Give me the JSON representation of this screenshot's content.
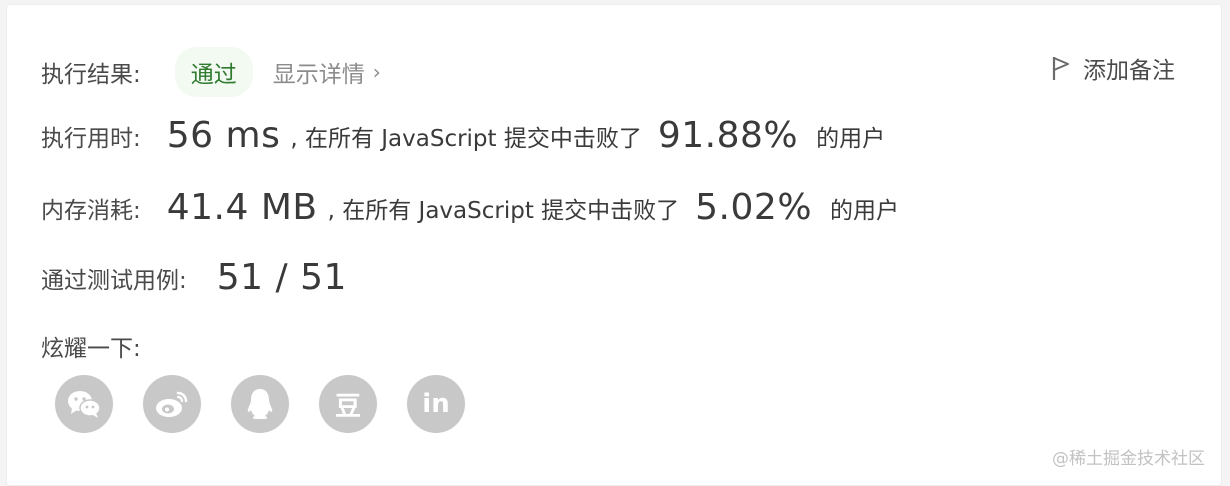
{
  "result": {
    "label": "执行结果:",
    "status": "通过",
    "details_link": "显示详情",
    "chevron": "›",
    "add_note": "添加备注"
  },
  "runtime": {
    "label": "执行用时:",
    "value": "56 ms",
    "text_before": ", 在所有 JavaScript 提交中击败了",
    "percent": "91.88%",
    "text_after": "的用户"
  },
  "memory": {
    "label": "内存消耗:",
    "value": "41.4 MB",
    "text_before": ", 在所有 JavaScript 提交中击败了",
    "percent": "5.02%",
    "text_after": "的用户"
  },
  "tests": {
    "label": "通过测试用例:",
    "value": "51 / 51"
  },
  "share": {
    "label": "炫耀一下:",
    "icons": [
      "wechat-icon",
      "weibo-icon",
      "qq-icon",
      "douban-icon",
      "linkedin-icon"
    ],
    "douban_glyph": "豆",
    "linkedin_glyph": "in"
  },
  "watermark": "@稀土掘金技术社区",
  "colors": {
    "success": "#2f7a2f",
    "success_bg": "#f3faf2",
    "icon_gray": "#c8c8c8"
  }
}
